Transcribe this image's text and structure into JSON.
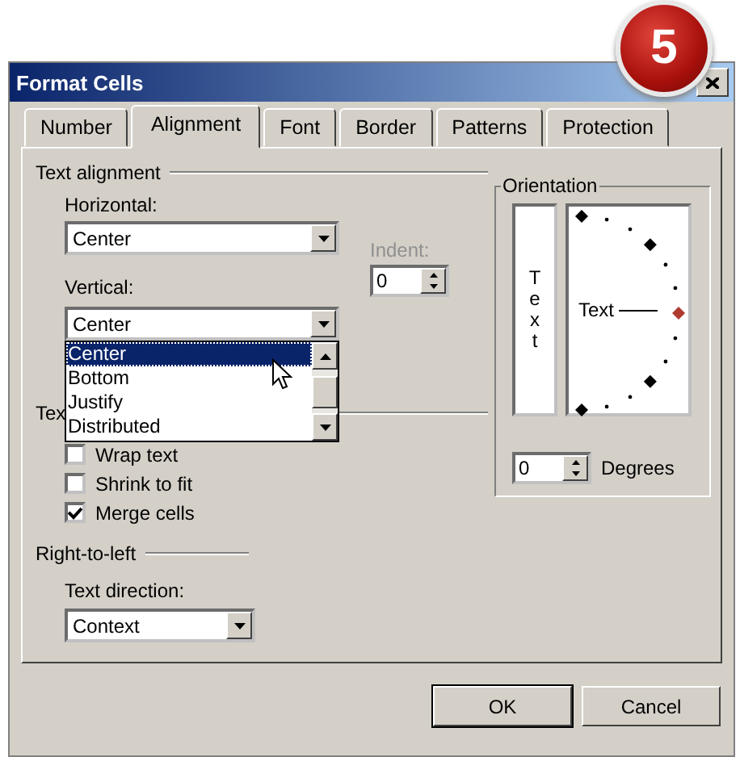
{
  "badge": "5",
  "window": {
    "title": "Format Cells"
  },
  "tabs": [
    {
      "label": "Number",
      "selected": false
    },
    {
      "label": "Alignment",
      "selected": true
    },
    {
      "label": "Font",
      "selected": false
    },
    {
      "label": "Border",
      "selected": false
    },
    {
      "label": "Patterns",
      "selected": false
    },
    {
      "label": "Protection",
      "selected": false
    }
  ],
  "text_alignment": {
    "heading": "Text alignment",
    "horizontal": {
      "label": "Horizontal:",
      "value": "Center"
    },
    "indent": {
      "label": "Indent:",
      "value": "0",
      "disabled": true
    },
    "vertical": {
      "label": "Vertical:",
      "value": "Center",
      "expanded": true,
      "options": [
        {
          "label": "Center",
          "selected": true
        },
        {
          "label": "Bottom",
          "selected": false
        },
        {
          "label": "Justify",
          "selected": false
        },
        {
          "label": "Distributed",
          "selected": false
        }
      ]
    }
  },
  "text_control": {
    "heading": "Tex",
    "options": [
      {
        "label": "Wrap text",
        "checked": false
      },
      {
        "label": "Shrink to fit",
        "checked": false
      },
      {
        "label": "Merge cells",
        "checked": true
      }
    ]
  },
  "right_to_left": {
    "heading": "Right-to-left",
    "text_direction": {
      "label": "Text direction:",
      "value": "Context"
    }
  },
  "orientation": {
    "heading": "Orientation",
    "vertical_text": "Text",
    "dial_text": "Text",
    "degrees": {
      "value": "0",
      "label": "Degrees"
    }
  },
  "buttons": [
    {
      "label": "OK",
      "default": true
    },
    {
      "label": "Cancel",
      "default": false
    }
  ]
}
